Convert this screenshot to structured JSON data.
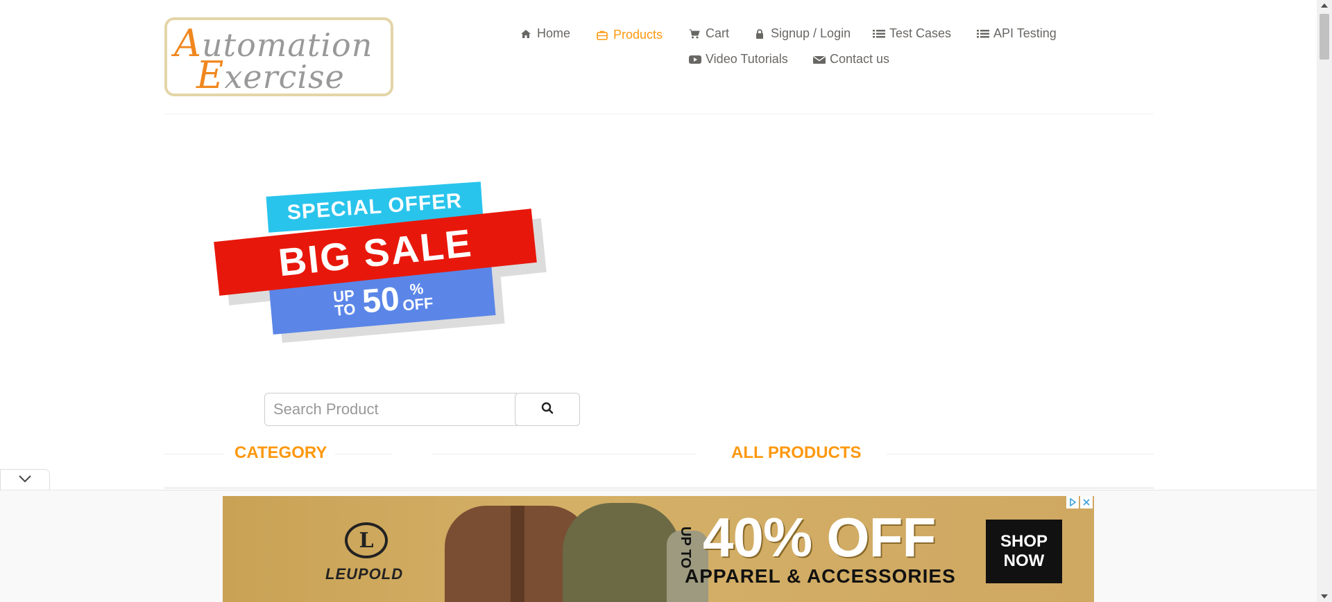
{
  "logo": {
    "line1_cap": "A",
    "line1_rest": "utomation",
    "line2_cap": "E",
    "line2_rest": "xercise"
  },
  "nav": {
    "items": [
      {
        "label": "Home",
        "icon": "home-icon"
      },
      {
        "label": "Products",
        "icon": "briefcase-icon",
        "active": true
      },
      {
        "label": "Cart",
        "icon": "cart-icon"
      },
      {
        "label": "Signup / Login",
        "icon": "lock-icon"
      },
      {
        "label": "Test Cases",
        "icon": "list-icon"
      },
      {
        "label": "API Testing",
        "icon": "list-icon"
      },
      {
        "label": "Video Tutorials",
        "icon": "youtube-icon"
      },
      {
        "label": "Contact us",
        "icon": "envelope-icon"
      }
    ],
    "active_color": "#fe980f",
    "text_color": "#696763"
  },
  "banner": {
    "special_offer": "SPECIAL OFFER",
    "big_sale": "BIG SALE",
    "up_to": "UP TO",
    "fifty": "50",
    "percent": "%",
    "off": "OFF"
  },
  "search": {
    "placeholder": "Search Product",
    "button_icon": "search-icon"
  },
  "sections": {
    "category": "CATEGORY",
    "all_products": "ALL PRODUCTS"
  },
  "ad": {
    "brand": "LEUPOLD",
    "up_to": "UP TO",
    "headline": "40% OFF",
    "subline": "APPAREL & ACCESSORIES",
    "cta_line1": "SHOP",
    "cta_line2": "NOW"
  }
}
